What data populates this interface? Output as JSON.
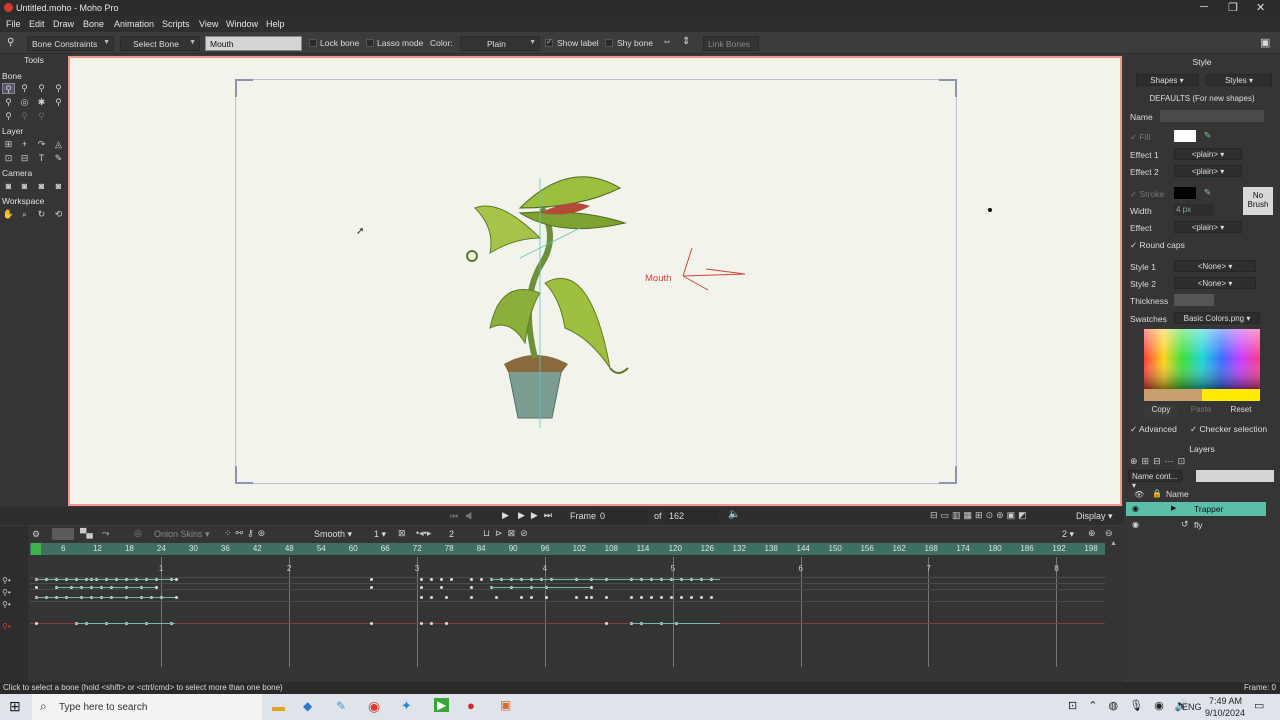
{
  "window": {
    "title": "Untitled.moho - Moho Pro"
  },
  "menu": [
    "File",
    "Edit",
    "Draw",
    "Bone",
    "Animation",
    "Scripts",
    "View",
    "Window",
    "Help"
  ],
  "toolbar": {
    "mode": "Bone Constraints",
    "select": "Select Bone",
    "bone_name": "Mouth",
    "lock_bone": "Lock bone",
    "lasso": "Lasso mode",
    "color_label": "Color:",
    "color_value": "Plain",
    "show_label": "Show label",
    "shy_bone": "Shy bone",
    "link_bones": "Link Bones"
  },
  "tools": {
    "title": "Tools",
    "sections": [
      "Bone",
      "Layer",
      "Camera",
      "Workspace"
    ]
  },
  "canvas": {
    "bone_label": "Mouth"
  },
  "style": {
    "title": "Style",
    "shapes": "Shapes",
    "styles": "Styles",
    "defaults": "DEFAULTS (For new shapes)",
    "name_label": "Name",
    "fill": "Fill",
    "effect1": "Effect 1",
    "effect2": "Effect 2",
    "plain": "<plain>",
    "stroke": "Stroke",
    "width": "Width",
    "width_value": "4 px",
    "no_brush": "No Brush",
    "effect": "Effect",
    "round_caps": "Round caps",
    "style1": "Style 1",
    "style2": "Style 2",
    "none": "<None>",
    "thickness": "Thickness",
    "swatches": "Swatches",
    "swatches_value": "Basic Colors.png",
    "copy": "Copy",
    "paste": "Paste",
    "reset": "Reset",
    "advanced": "Advanced",
    "checker": "Checker selection"
  },
  "layers": {
    "title": "Layers",
    "name_filter": "Name cont...",
    "col_name": "Name",
    "items": [
      "Trapper",
      "fly"
    ]
  },
  "transport": {
    "frame_label": "Frame",
    "frame": "0",
    "of": "of",
    "total": "162",
    "display": "Display"
  },
  "timeline": {
    "onion": "Onion Skins",
    "interp": "Smooth",
    "interp_num": "1",
    "num2": "2",
    "num3": "2",
    "ticks": [
      "6",
      "12",
      "18",
      "24",
      "30",
      "36",
      "42",
      "48",
      "54",
      "60",
      "66",
      "72",
      "78",
      "84",
      "90",
      "96",
      "102",
      "108",
      "114",
      "120",
      "126",
      "132",
      "138",
      "144",
      "150",
      "156",
      "162",
      "168",
      "174",
      "180",
      "186",
      "192",
      "198"
    ],
    "seconds": [
      "1",
      "2",
      "3",
      "4",
      "5",
      "6",
      "7",
      "8"
    ]
  },
  "status": {
    "message": "Click to select a bone (hold <shift> or <ctrl/cmd> to select more than one bone)",
    "frame": "Frame: 0"
  },
  "taskbar": {
    "search": "Type here to search",
    "lang": "ENG",
    "time": "7:49 AM",
    "date": "9/10/2024"
  },
  "colors": {
    "accent": "#3f6e62",
    "canvas_border": "#f19a8c",
    "selected_layer": "#5bbfa8"
  }
}
